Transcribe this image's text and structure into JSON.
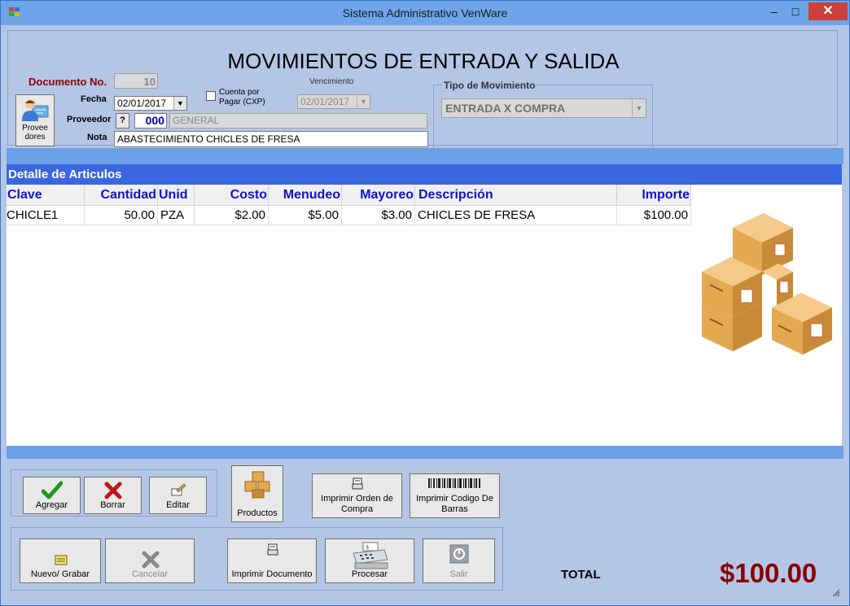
{
  "window": {
    "title": "Sistema Administrativo VenWare",
    "minimize": "–",
    "maximize": "□",
    "close": "✕"
  },
  "header": {
    "title": "MOVIMIENTOS DE ENTRADA Y SALIDA",
    "documento_label": "Documento No.",
    "documento_value": "10",
    "proveedores_button": "Provee dores",
    "fecha_label": "Fecha",
    "fecha_value": "02/01/2017",
    "cxp_label_1": "Cuenta por",
    "cxp_label_2": "Pagar (CXP)",
    "cxp_checked": false,
    "vencimiento_label": "Vencimiento",
    "vencimiento_value": "02/01/2017",
    "proveedor_label": "Proveedor",
    "proveedor_search": "?",
    "proveedor_code": "000",
    "proveedor_name": "GENERAL",
    "nota_label": "Nota",
    "nota_value": "ABASTECIMIENTO CHICLES DE FRESA",
    "tipo_label": "Tipo de Movimiento",
    "tipo_value": "ENTRADA X COMPRA"
  },
  "detail": {
    "title": "Detalle de Articulos",
    "columns": [
      "Clave",
      "Cantidad",
      "Unid",
      "Costo",
      "Menudeo",
      "Mayoreo",
      "Descripción",
      "Importe"
    ],
    "rows": [
      [
        "CHICLE1",
        "50.00",
        "PZA",
        "$2.00",
        "$5.00",
        "$3.00",
        "CHICLES DE FRESA",
        "$100.00"
      ]
    ]
  },
  "actions": {
    "agregar": "Agregar",
    "borrar": "Borrar",
    "editar": "Editar",
    "productos": "Productos",
    "imprimir_orden_1": "Imprimir Orden de",
    "imprimir_orden_2": "Compra",
    "imprimir_codigo_1": "Imprimir Codigo De",
    "imprimir_codigo_2": "Barras",
    "nuevo": "Nuevo/ Grabar",
    "cancelar": "Cancelar",
    "imprimir_documento": "Imprimir Documento",
    "procesar": "Procesar",
    "salir": "Salir"
  },
  "total": {
    "label": "TOTAL",
    "value": "$100.00"
  },
  "colors": {
    "band": "#6aa0e8",
    "detail_header": "#3a66e0",
    "column_header_text": "#1010d0",
    "total": "#8b0000"
  }
}
